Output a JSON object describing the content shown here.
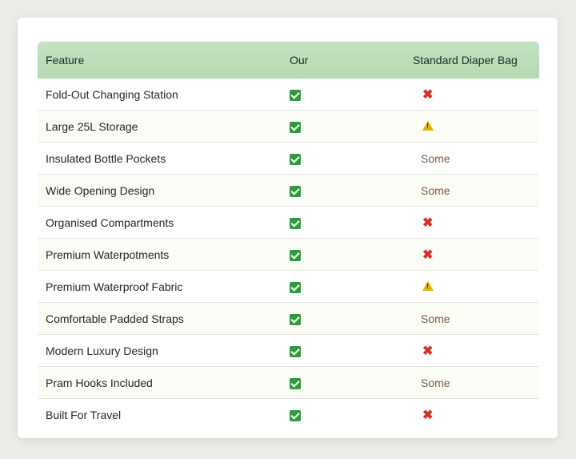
{
  "header": {
    "feature": "Feature",
    "ours": "Our",
    "standard": "Standard Diaper Bag"
  },
  "rows": [
    {
      "feature": "Fold-Out Changing Station",
      "ours": "check",
      "standard": "cross"
    },
    {
      "feature": "Large 25L Storage",
      "ours": "check",
      "standard": "warning"
    },
    {
      "feature": "Insulated Bottle Pockets",
      "ours": "check",
      "standard": "Some"
    },
    {
      "feature": "Wide Opening Design",
      "ours": "check",
      "standard": "Some"
    },
    {
      "feature": "Organised Compartments",
      "ours": "check",
      "standard": "cross"
    },
    {
      "feature": "Premium Waterpotments",
      "ours": "check",
      "standard": "cross"
    },
    {
      "feature": "Premium Waterproof Fabric",
      "ours": "check",
      "standard": "warning"
    },
    {
      "feature": "Comfortable Padded Straps",
      "ours": "check",
      "standard": "Some"
    },
    {
      "feature": "Modern Luxury Design",
      "ours": "check",
      "standard": "cross"
    },
    {
      "feature": "Pram Hooks Included",
      "ours": "check",
      "standard": "Some"
    },
    {
      "feature": "Built For Travel",
      "ours": "check",
      "standard": "cross"
    }
  ],
  "colors": {
    "header": "#b9dcb7",
    "check": "#2e9c3c",
    "cross": "#d32f2f",
    "warning": "#e0b400",
    "some": "#7a5a48"
  }
}
